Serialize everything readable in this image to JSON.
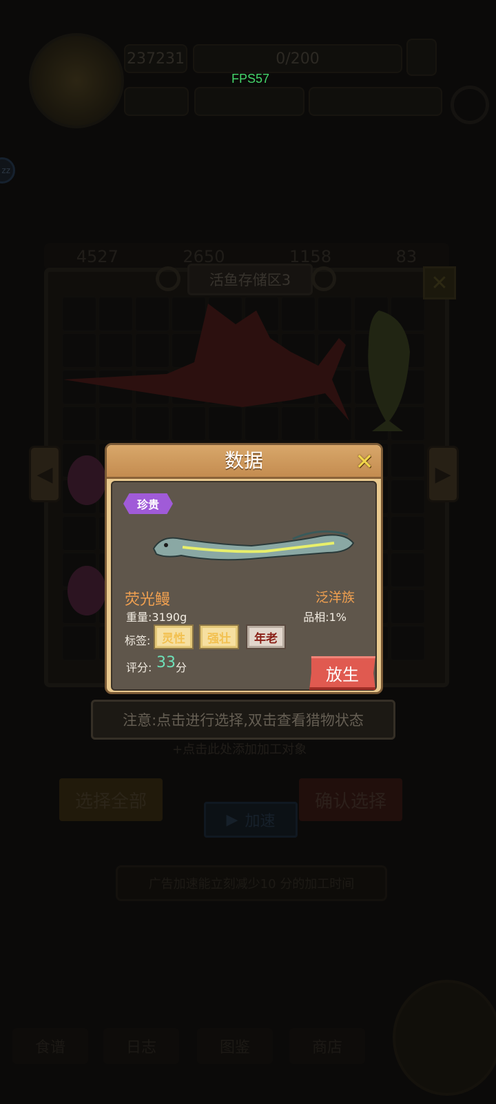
{
  "hud": {
    "fps": "FPS57",
    "res1": "237231",
    "res2": "0/200"
  },
  "storage": {
    "stats": [
      "4527",
      "2650",
      "1158",
      "83"
    ],
    "title": "活鱼存储区3"
  },
  "notice": "注意:点击进行选择,双击查看猎物状态",
  "add_hint": "+点击此处添加加工对象",
  "buttons": {
    "select_all": "选择全部",
    "confirm": "确认选择",
    "speed": "加速"
  },
  "ad_hint": "广告加速能立刻减少10 分的加工时间",
  "bottom_tabs": [
    "食谱",
    "日志",
    "图鉴",
    "商店"
  ],
  "modal": {
    "title": "数据",
    "rarity": "珍贵",
    "fish_name": "荧光鳗",
    "family": "泛洋族",
    "weight": "重量:3190g",
    "quality": "品相:1%",
    "tags_label": "标签:",
    "tags": [
      "灵性",
      "强壮",
      "年老"
    ],
    "score_label": "评分:",
    "score": "33",
    "score_unit": "分",
    "release": "放生"
  },
  "colors": {
    "modal_frame": "#e9c98e",
    "modal_inner": "#5f564b",
    "rarity_purple": "#a05bd8",
    "name_orange": "#f0a050",
    "score_teal": "#6ee0b8",
    "release_red": "#e05a50"
  }
}
